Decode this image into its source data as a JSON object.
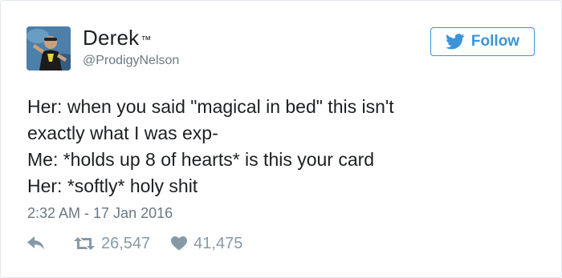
{
  "author": {
    "display_name": "Derek",
    "trademark": "™",
    "handle": "@ProdigyNelson",
    "avatar_icon": "profile-photo"
  },
  "follow_button": {
    "label": "Follow",
    "icon": "twitter-bird-icon",
    "color": "#3b94d9"
  },
  "tweet": {
    "lines": [
      "Her: when you said \"magical in bed\" this isn't",
      "exactly what I was exp-",
      "Me: *holds up 8 of hearts* is this your card",
      "Her: *softly* holy shit"
    ],
    "timestamp": "2:32 AM - 17 Jan 2016"
  },
  "actions": {
    "reply_icon": "reply-icon",
    "retweet_icon": "retweet-icon",
    "retweet_count": "26,547",
    "like_icon": "heart-icon",
    "like_count": "41,475"
  }
}
